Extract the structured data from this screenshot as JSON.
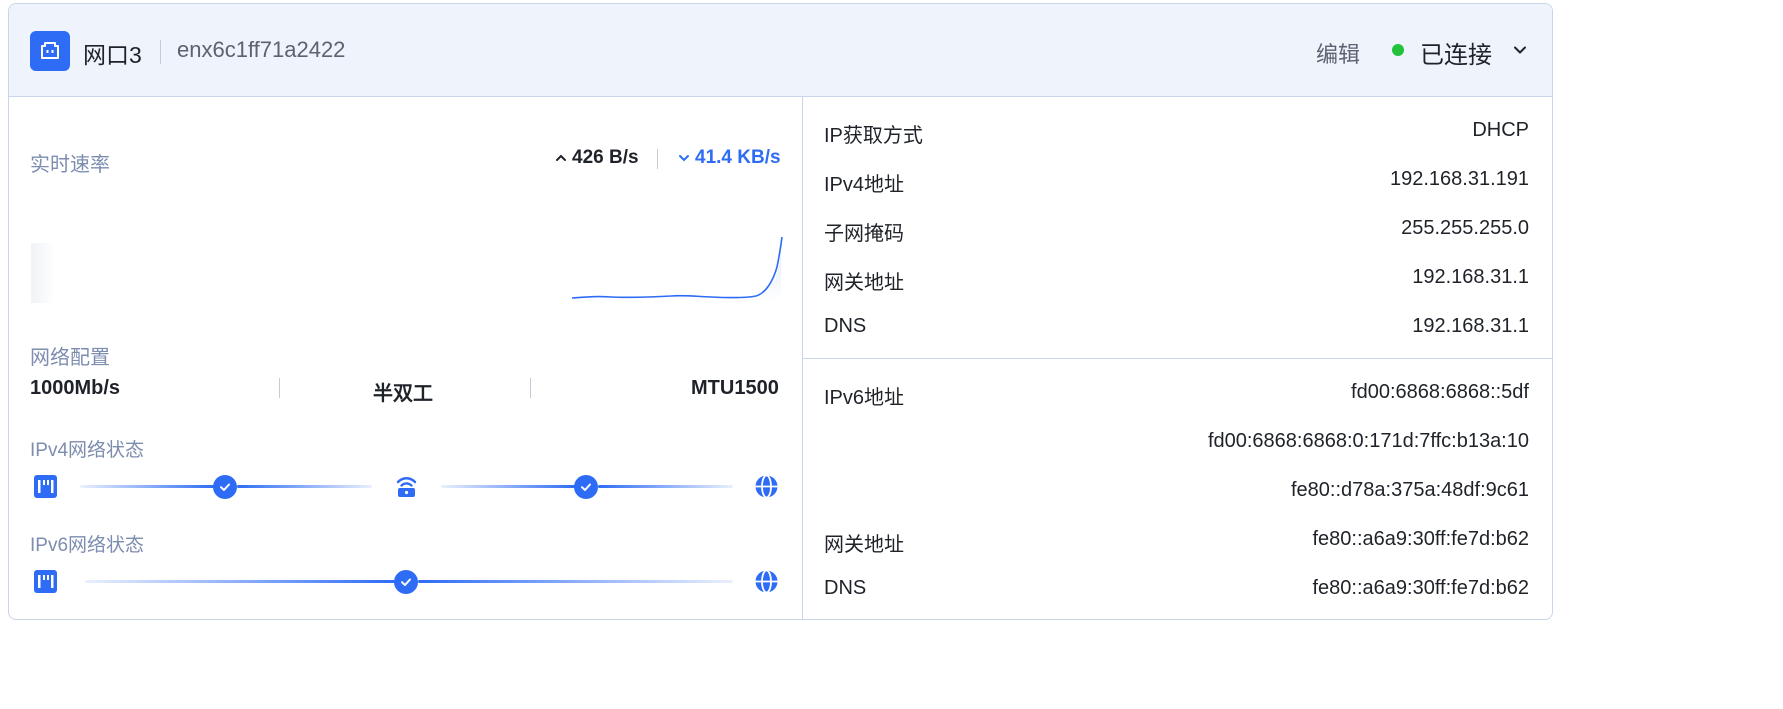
{
  "header": {
    "port_name": "网口3",
    "interface": "enx6c1ff71a2422",
    "edit_label": "编辑",
    "status": "已连接",
    "status_color": "#22c33a",
    "icon": "ethernet-port-icon"
  },
  "realtime": {
    "label": "实时速率",
    "upload": "426 B/s",
    "download": "41.4 KB/s",
    "upload_icon": "chevron-up-icon",
    "download_icon": "chevron-down-icon",
    "accent": "#2e6cf6"
  },
  "network_config": {
    "label": "网络配置",
    "speed": "1000Mb/s",
    "duplex": "半双工",
    "mtu": "MTU1500"
  },
  "ipv4_status": {
    "label": "IPv4网络状态",
    "nodes": [
      "device-icon",
      "router-icon",
      "globe-icon"
    ],
    "checks": 2
  },
  "ipv6_status": {
    "label": "IPv6网络状态",
    "nodes": [
      "device-icon",
      "globe-icon"
    ],
    "checks": 1
  },
  "ipv4_info": [
    {
      "key": "IP获取方式",
      "value": "DHCP"
    },
    {
      "key": "IPv4地址",
      "value": "192.168.31.191"
    },
    {
      "key": "子网掩码",
      "value": "255.255.255.0"
    },
    {
      "key": "网关地址",
      "value": "192.168.31.1"
    },
    {
      "key": "DNS",
      "value": "192.168.31.1"
    }
  ],
  "ipv6_info": [
    {
      "key": "IPv6地址",
      "value": "fd00:6868:6868::5df"
    },
    {
      "key": "",
      "value": "fd00:6868:6868:0:171d:7ffc:b13a:10"
    },
    {
      "key": "",
      "value": "fe80::d78a:375a:48df:9c61"
    },
    {
      "key": "网关地址",
      "value": "fe80::a6a9:30ff:fe7d:b62"
    },
    {
      "key": "DNS",
      "value": "fe80::a6a9:30ff:fe7d:b62"
    }
  ]
}
